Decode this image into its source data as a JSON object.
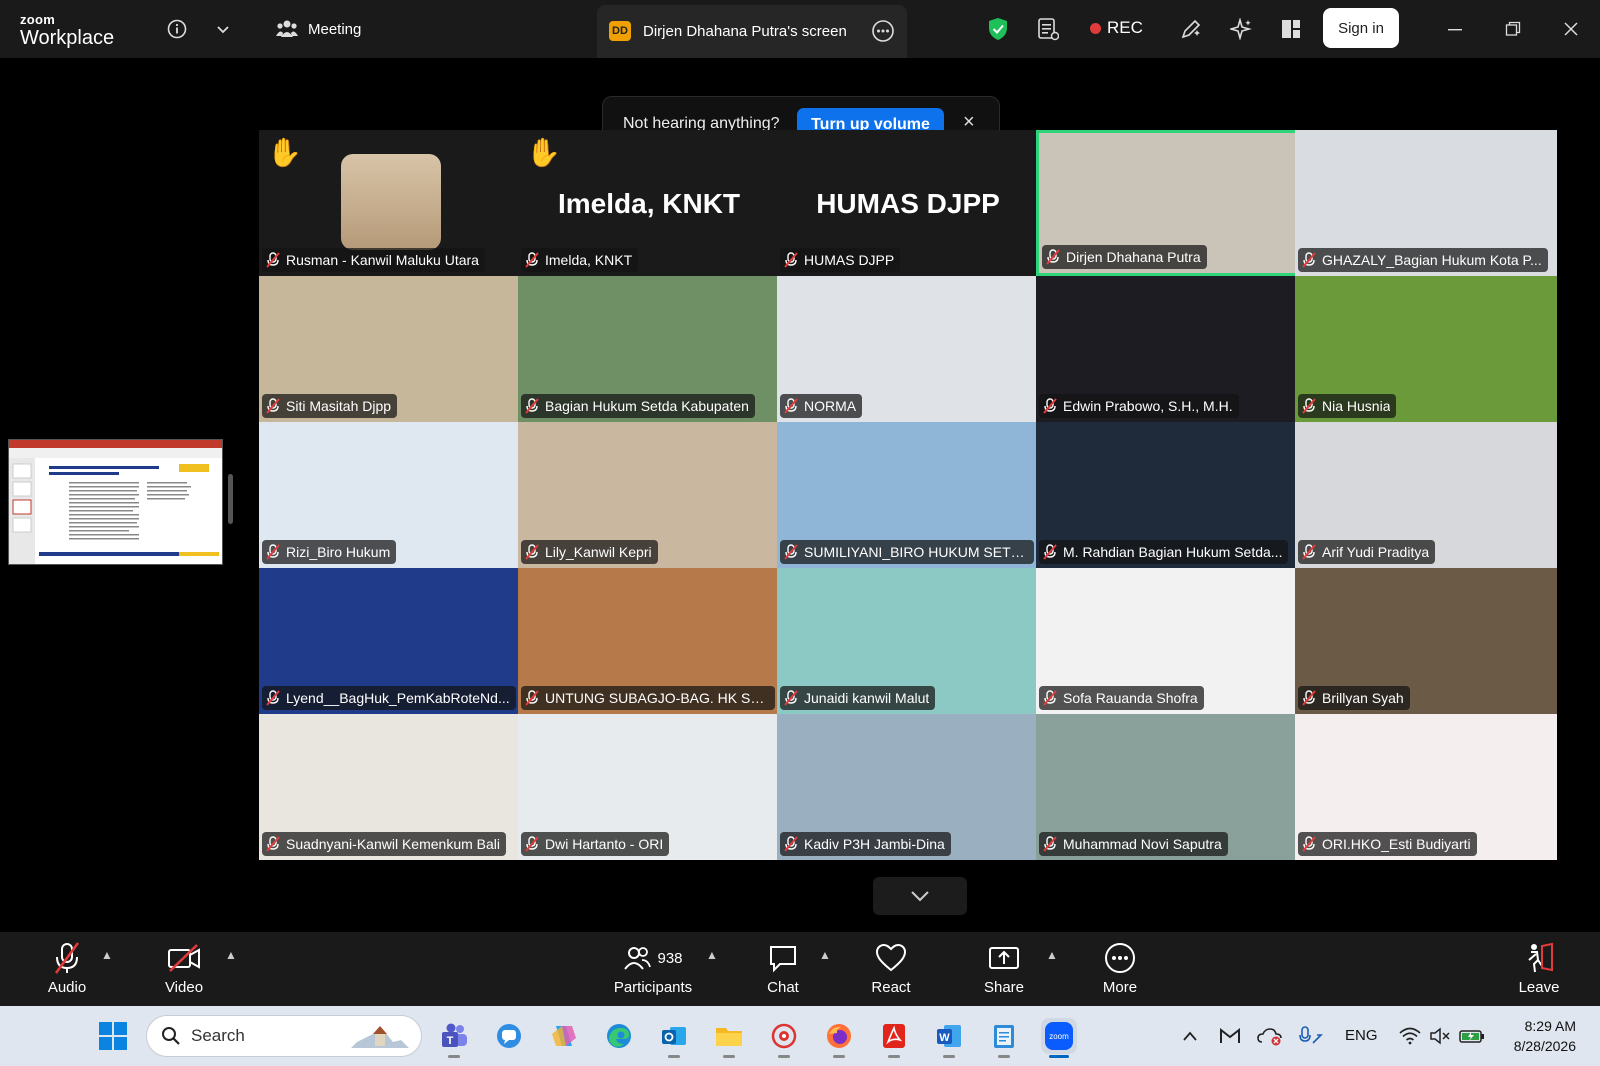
{
  "titlebar": {
    "brand_top": "zoom",
    "brand_bottom": "Workplace",
    "meeting_label": "Meeting",
    "share_badge": "DD",
    "share_tab_label": "Dirjen Dhahana Putra's screen",
    "rec_label": "REC",
    "signin_label": "Sign in"
  },
  "banner": {
    "text": "Not hearing anything?",
    "button": "Turn up volume",
    "close": "×"
  },
  "tiles": [
    {
      "name": "Rusman - Kanwil Maluku Utara",
      "hand": true,
      "big": "",
      "active": false
    },
    {
      "name": "Imelda, KNKT",
      "hand": true,
      "big": "Imelda, KNKT",
      "active": false
    },
    {
      "name": "HUMAS DJPP",
      "hand": false,
      "big": "HUMAS DJPP",
      "active": false
    },
    {
      "name": "Dirjen Dhahana Putra",
      "hand": false,
      "big": "",
      "active": true
    },
    {
      "name": "GHAZALY_Bagian Hukum Kota P...",
      "hand": false,
      "big": "",
      "active": false
    },
    {
      "name": "Siti Masitah Djpp",
      "hand": false,
      "big": "",
      "active": false
    },
    {
      "name": "Bagian Hukum Setda Kabupaten",
      "hand": false,
      "big": "",
      "active": false
    },
    {
      "name": "NORMA",
      "hand": false,
      "big": "",
      "active": false
    },
    {
      "name": "Edwin Prabowo, S.H., M.H.",
      "hand": false,
      "big": "",
      "active": false
    },
    {
      "name": "Nia Husnia",
      "hand": false,
      "big": "",
      "active": false
    },
    {
      "name": "Rizi_Biro Hukum",
      "hand": false,
      "big": "",
      "active": false
    },
    {
      "name": "Lily_Kanwil Kepri",
      "hand": false,
      "big": "",
      "active": false
    },
    {
      "name": "SUMILIYANI_BIRO HUKUM SETD...",
      "hand": false,
      "big": "",
      "active": false
    },
    {
      "name": "M. Rahdian Bagian Hukum Setda...",
      "hand": false,
      "big": "",
      "active": false
    },
    {
      "name": "Arif Yudi Praditya",
      "hand": false,
      "big": "",
      "active": false
    },
    {
      "name": "Lyend__BagHuk_PemKabRoteNd...",
      "hand": false,
      "big": "",
      "active": false
    },
    {
      "name": "UNTUNG SUBAGJO-BAG. HK SET...",
      "hand": false,
      "big": "",
      "active": false
    },
    {
      "name": "Junaidi kanwil Malut",
      "hand": false,
      "big": "",
      "active": false
    },
    {
      "name": "Sofa Rauanda Shofra",
      "hand": false,
      "big": "",
      "active": false
    },
    {
      "name": "Brillyan Syah",
      "hand": false,
      "big": "",
      "active": false
    },
    {
      "name": "Suadnyani-Kanwil Kemenkum Bali",
      "hand": false,
      "big": "",
      "active": false
    },
    {
      "name": "Dwi Hartanto - ORI",
      "hand": false,
      "big": "",
      "active": false
    },
    {
      "name": "Kadiv P3H Jambi-Dina",
      "hand": false,
      "big": "",
      "active": false
    },
    {
      "name": "Muhammad Novi Saputra",
      "hand": false,
      "big": "",
      "active": false
    },
    {
      "name": "ORI.HKO_Esti Budiyarti",
      "hand": false,
      "big": "",
      "active": false
    }
  ],
  "tile_backgrounds": [
    "#1a1a1a",
    "#1a1a1a",
    "#1a1a1a",
    "#c9c3b8",
    "#d9dde2",
    "#c7b79a",
    "#6f8f64",
    "#dfe3e8",
    "#1c1c22",
    "#6a9a3a",
    "#dfe7f0",
    "#c9b7a0",
    "#8fb6d6",
    "#1f2a3a",
    "#d6d8dc",
    "#1f3b8a",
    "#b5794a",
    "#8dc9c4",
    "#f2f2f2",
    "#6b5a45",
    "#e9e6e0",
    "#e7ebee",
    "#9ab0c0",
    "#8aa09a",
    "#f4eeee"
  ],
  "thumbnail": {
    "title": "Ilustrasi #1 Penerapan Pasal 613 ayat (3) UU Perasuransian"
  },
  "toolbar": {
    "audio": "Audio",
    "video": "Video",
    "participants": "Participants",
    "participants_count": "938",
    "chat": "Chat",
    "react": "React",
    "share": "Share",
    "more": "More",
    "leave": "Leave"
  },
  "taskbar": {
    "search_placeholder": "Search",
    "language": "ENG",
    "time": "8:29 AM",
    "date": "8/28/2026"
  },
  "colors": {
    "accent_blue": "#0e72ed",
    "active_speaker": "#2ed47a",
    "mute_red": "#e23b3b",
    "rec_red": "#e23b3b",
    "raise_hand": "#f5c33b"
  }
}
